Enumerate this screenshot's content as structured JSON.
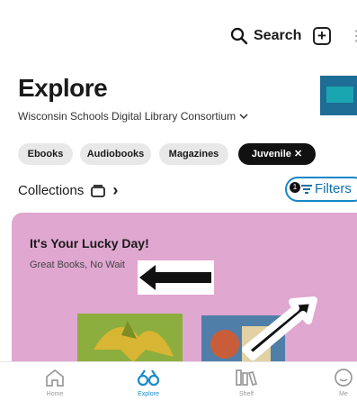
{
  "header": {
    "search_label": "Search",
    "plus_label": "+"
  },
  "explore": {
    "title": "Explore",
    "library": "Wisconsin Schools Digital Library Consortium"
  },
  "chips": [
    {
      "label": "Ebooks"
    },
    {
      "label": "Audiobooks"
    },
    {
      "label": "Magazines"
    },
    {
      "label": "Juvenile"
    }
  ],
  "collections": {
    "label": "Collections",
    "filters_label": "Filters",
    "filters_count": "1"
  },
  "hero": {
    "title": "It's Your Lucky Day!",
    "subtitle": "Great Books, No Wait"
  },
  "nav": [
    {
      "label": "Home",
      "icon": "home-icon"
    },
    {
      "label": "Explore",
      "icon": "explore-icon"
    },
    {
      "label": "Shelf",
      "icon": "shelf-icon"
    },
    {
      "label": "Me",
      "icon": "me-icon"
    }
  ],
  "colors": {
    "accent": "#188bcc",
    "hero_background": "#e0a7d0",
    "active_chip": "#111111"
  }
}
